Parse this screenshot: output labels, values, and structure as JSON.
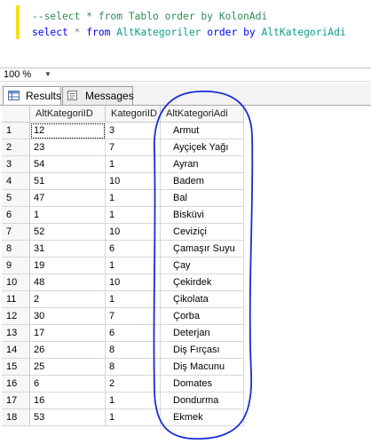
{
  "editor": {
    "lines": [
      {
        "comment": "--select * from Tablo order by KolonAdi"
      },
      {
        "kw1": "select",
        "star": " * ",
        "kw2": "from",
        "table": " AltKategoriler ",
        "kw3": "order by",
        "column": " AltKategoriAdi"
      }
    ],
    "highlight_color": "#f5df1e"
  },
  "zoom": {
    "value": "100 %"
  },
  "tabs": {
    "results_label": "Results",
    "messages_label": "Messages"
  },
  "grid": {
    "columns": [
      "AltKategoriID",
      "KategoriID",
      "AltKategoriAdi"
    ],
    "rows": [
      {
        "n": "1",
        "id": "12",
        "kat": "3",
        "ad": "Armut"
      },
      {
        "n": "2",
        "id": "23",
        "kat": "7",
        "ad": "Ayçiçek Yağı"
      },
      {
        "n": "3",
        "id": "54",
        "kat": "1",
        "ad": "Ayran"
      },
      {
        "n": "4",
        "id": "51",
        "kat": "10",
        "ad": "Badem"
      },
      {
        "n": "5",
        "id": "47",
        "kat": "1",
        "ad": "Bal"
      },
      {
        "n": "6",
        "id": "1",
        "kat": "1",
        "ad": "Bisküvi"
      },
      {
        "n": "7",
        "id": "52",
        "kat": "10",
        "ad": "Ceviziçi"
      },
      {
        "n": "8",
        "id": "31",
        "kat": "6",
        "ad": "Çamaşır Suyu"
      },
      {
        "n": "9",
        "id": "19",
        "kat": "1",
        "ad": "Çay"
      },
      {
        "n": "10",
        "id": "48",
        "kat": "10",
        "ad": "Çekirdek"
      },
      {
        "n": "11",
        "id": "2",
        "kat": "1",
        "ad": "Çikolata"
      },
      {
        "n": "12",
        "id": "30",
        "kat": "7",
        "ad": "Çorba"
      },
      {
        "n": "13",
        "id": "17",
        "kat": "6",
        "ad": "Deterjan"
      },
      {
        "n": "14",
        "id": "26",
        "kat": "8",
        "ad": "Diş Fırçası"
      },
      {
        "n": "15",
        "id": "25",
        "kat": "8",
        "ad": "Diş Macunu"
      },
      {
        "n": "16",
        "id": "6",
        "kat": "2",
        "ad": "Domates"
      },
      {
        "n": "17",
        "id": "16",
        "kat": "1",
        "ad": "Dondurma"
      },
      {
        "n": "18",
        "id": "53",
        "kat": "1",
        "ad": "Ekmek"
      }
    ]
  },
  "annotation": {
    "color": "#1a2bd6"
  }
}
